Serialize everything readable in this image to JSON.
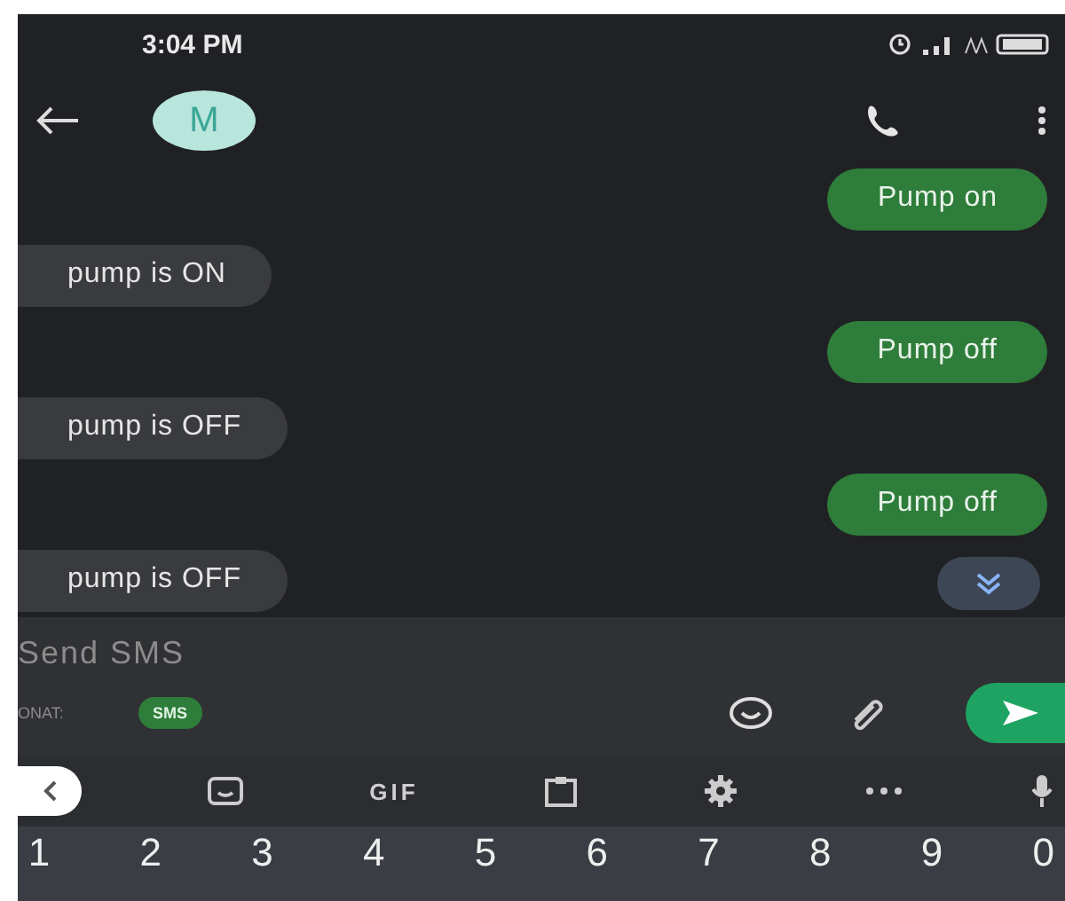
{
  "status_bar": {
    "time": "3:04 PM"
  },
  "header": {
    "avatar_letter": "M"
  },
  "messages": [
    {
      "text": "Pump on",
      "kind": "outgoing"
    },
    {
      "text": "pump is ON",
      "kind": "incoming"
    },
    {
      "text": "Pump off",
      "kind": "outgoing"
    },
    {
      "text": "pump is OFF",
      "kind": "incoming"
    },
    {
      "text": "Pump off",
      "kind": "outgoing"
    },
    {
      "text": "pump is OFF",
      "kind": "incoming"
    }
  ],
  "compose": {
    "placeholder": "Send SMS",
    "label": "ONAT:",
    "badge": "SMS"
  },
  "keyboard_toolbar": {
    "gif": "GIF"
  },
  "number_keys": [
    "1",
    "2",
    "3",
    "4",
    "5",
    "6",
    "7",
    "8",
    "9",
    "0"
  ]
}
